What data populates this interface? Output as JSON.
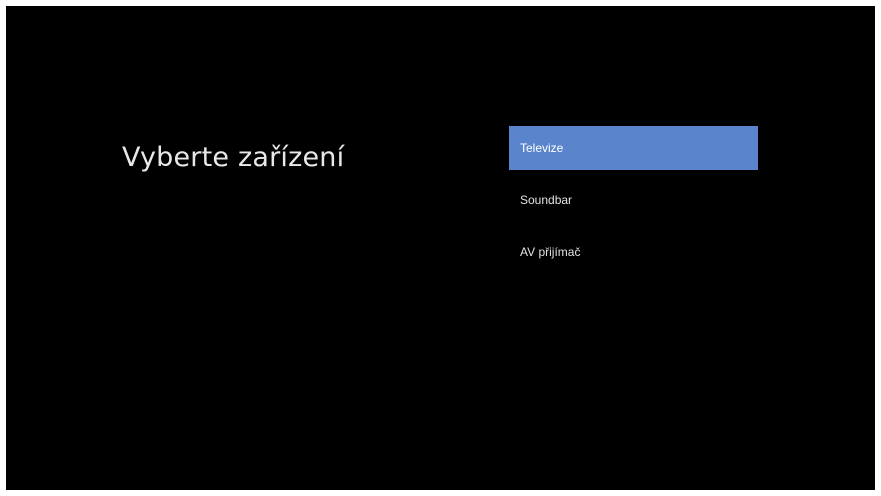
{
  "screen": {
    "title": "Vyberte zařízení"
  },
  "menu": {
    "items": [
      {
        "label": "Televize",
        "selected": true
      },
      {
        "label": "Soundbar",
        "selected": false
      },
      {
        "label": "AV přijímač",
        "selected": false
      }
    ]
  },
  "colors": {
    "background": "#000000",
    "selected_item": "#5a84cc",
    "text": "#e8e8e8"
  }
}
